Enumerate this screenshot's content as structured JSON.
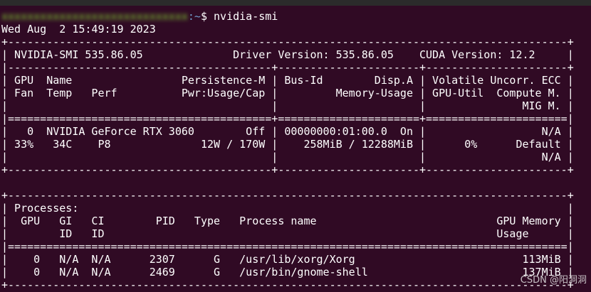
{
  "terminal": {
    "prompt": {
      "user_host": "xxxxxxxxxxxxxxxxxxxxxxxxxxxxx",
      "path": ":~",
      "symbol": "$",
      "command": " nvidia-smi"
    },
    "output": [
      "Wed Aug  2 15:49:19 2023",
      "+---------------------------------------------------------------------------------------+",
      "| NVIDIA-SMI 535.86.05              Driver Version: 535.86.05    CUDA Version: 12.2     |",
      "|-----------------------------------------+----------------------+----------------------+",
      "| GPU  Name                 Persistence-M | Bus-Id        Disp.A | Volatile Uncorr. ECC |",
      "| Fan  Temp   Perf          Pwr:Usage/Cap |         Memory-Usage | GPU-Util  Compute M. |",
      "|                                         |                      |               MIG M. |",
      "|=========================================+======================+======================|",
      "|   0  NVIDIA GeForce RTX 3060        Off | 00000000:01:00.0  On |                  N/A |",
      "| 33%   34C    P8              12W / 170W |    258MiB / 12288MiB |      0%      Default |",
      "|                                         |                      |                  N/A |",
      "+-----------------------------------------+----------------------+----------------------+",
      "",
      "+---------------------------------------------------------------------------------------+",
      "| Processes:                                                                            |",
      "|  GPU   GI   CI        PID   Type   Process name                            GPU Memory |",
      "|        ID   ID                                                             Usage      |",
      "|=======================================================================================|",
      "|    0   N/A  N/A      2307      G   /usr/lib/xorg/Xorg                          113MiB |",
      "|    0   N/A  N/A      2469      G   /usr/bin/gnome-shell                        137MiB |",
      "+---------------------------------------------------------------------------------------+"
    ]
  },
  "watermark": "CSDN @阳洞洞"
}
